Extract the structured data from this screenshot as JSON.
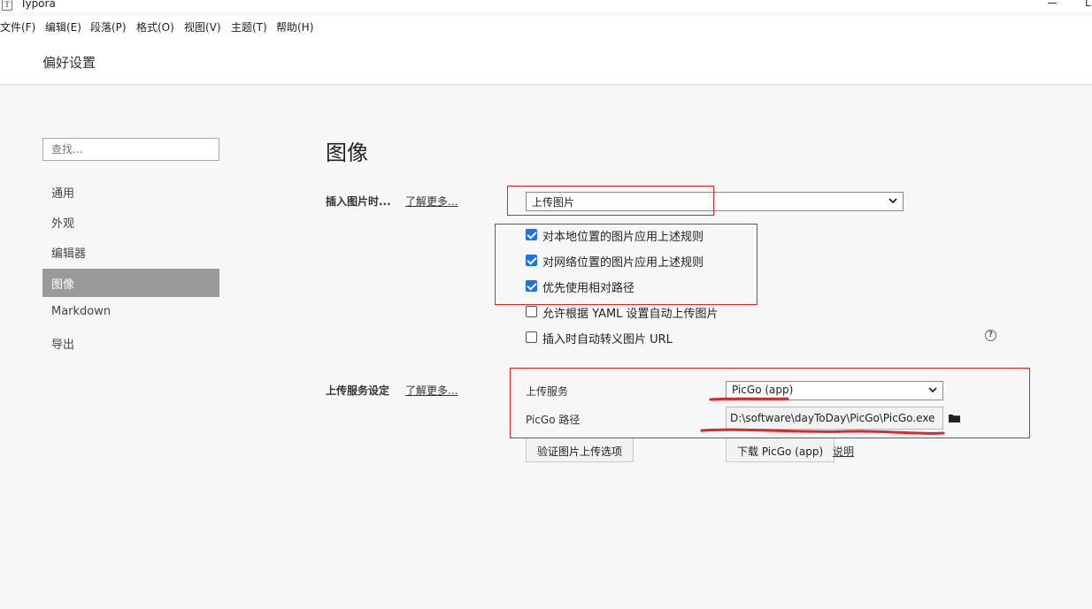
{
  "window": {
    "app_icon_glyph": "T",
    "title": "Typora"
  },
  "menu": {
    "items": [
      {
        "label": "文件(F)"
      },
      {
        "label": "编辑(E)"
      },
      {
        "label": "段落(P)"
      },
      {
        "label": "格式(O)"
      },
      {
        "label": "视图(V)"
      },
      {
        "label": "主题(T)"
      },
      {
        "label": "帮助(H)"
      }
    ]
  },
  "header": {
    "title": "偏好设置"
  },
  "sidebar": {
    "search_placeholder": "查找...",
    "items": [
      {
        "label": "通用",
        "active": false
      },
      {
        "label": "外观",
        "active": false
      },
      {
        "label": "编辑器",
        "active": false
      },
      {
        "label": "图像",
        "active": true
      },
      {
        "label": "Markdown",
        "active": false
      },
      {
        "label": "导出",
        "active": false
      }
    ]
  },
  "main": {
    "section_title": "图像",
    "insert": {
      "label": "插入图片时...",
      "learn_more": "了解更多...",
      "selected": "上传图片",
      "options": [
        {
          "label": "对本地位置的图片应用上述规则",
          "checked": true
        },
        {
          "label": "对网络位置的图片应用上述规则",
          "checked": true
        },
        {
          "label": "优先使用相对路径",
          "checked": true
        },
        {
          "label": "允许根据 YAML 设置自动上传图片",
          "checked": false
        },
        {
          "label": "插入时自动转义图片 URL",
          "checked": false
        }
      ],
      "help_glyph": "?"
    },
    "upload": {
      "label": "上传服务设定",
      "learn_more": "了解更多...",
      "service_label": "上传服务",
      "service_selected": "PicGo (app)",
      "path_label": "PicGo 路径",
      "path_value": "D:\\software\\dayToDay\\PicGo\\PicGo.exe",
      "verify_button": "验证图片上传选项",
      "download_button": "下载 PicGo (app)",
      "explain_link": "说明"
    }
  },
  "annotation_color": "#e0262b",
  "icons": {
    "app": "typora-icon",
    "select_arrow": "chevron-down-icon",
    "folder": "folder-icon",
    "help": "help-circle-icon"
  }
}
